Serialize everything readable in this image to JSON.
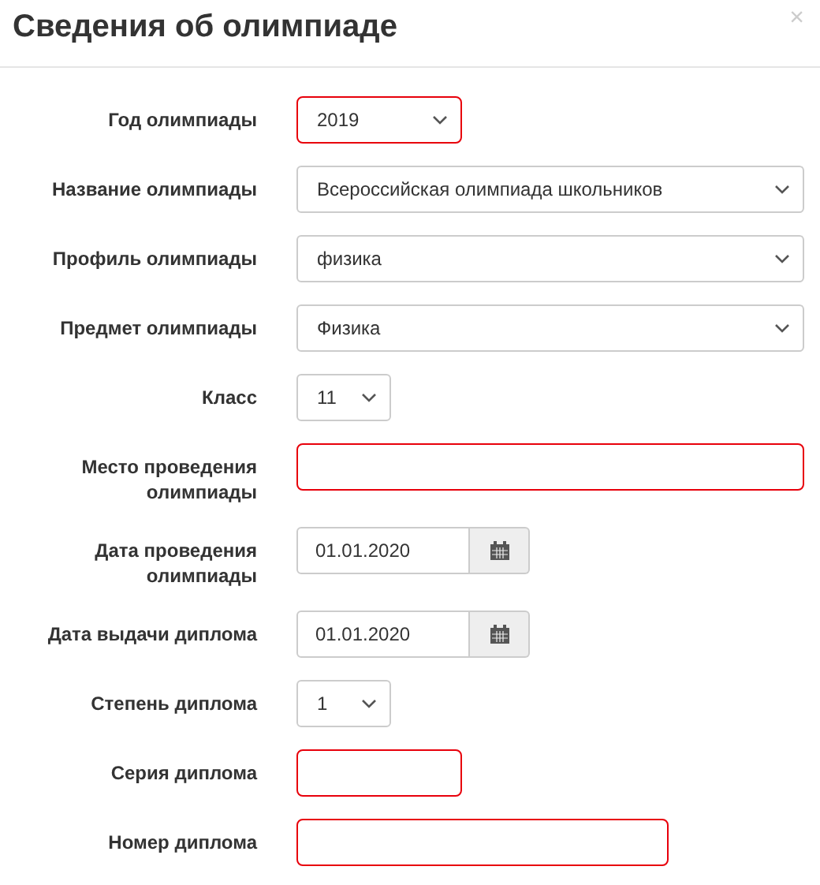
{
  "title": "Сведения об олимпиаде",
  "close": "×",
  "fields": [
    {
      "label": "Год олимпиады",
      "kind": "select",
      "value": "2019",
      "invalid": true
    },
    {
      "label": "Название олимпиады",
      "kind": "select",
      "value": "Всероссийская олимпиада школьников",
      "invalid": false
    },
    {
      "label": "Профиль олимпиады",
      "kind": "select",
      "value": "физика",
      "invalid": false
    },
    {
      "label": "Предмет олимпиады",
      "kind": "select",
      "value": "Физика",
      "invalid": false
    },
    {
      "label": "Класс",
      "kind": "select",
      "value": "11",
      "invalid": false
    },
    {
      "label": "Место проведения олимпиады",
      "kind": "text",
      "invalid": true
    },
    {
      "label": "Дата проведения олимпиады",
      "kind": "date",
      "value": "01.01.2020",
      "invalid": false
    },
    {
      "label": "Дата выдачи диплома",
      "kind": "date",
      "value": "01.01.2020",
      "invalid": false
    },
    {
      "label": "Степень диплома",
      "kind": "select",
      "value": "1",
      "invalid": false
    },
    {
      "label": "Серия диплома",
      "kind": "text",
      "invalid": true
    },
    {
      "label": "Номер диплома",
      "kind": "text",
      "invalid": true
    }
  ]
}
